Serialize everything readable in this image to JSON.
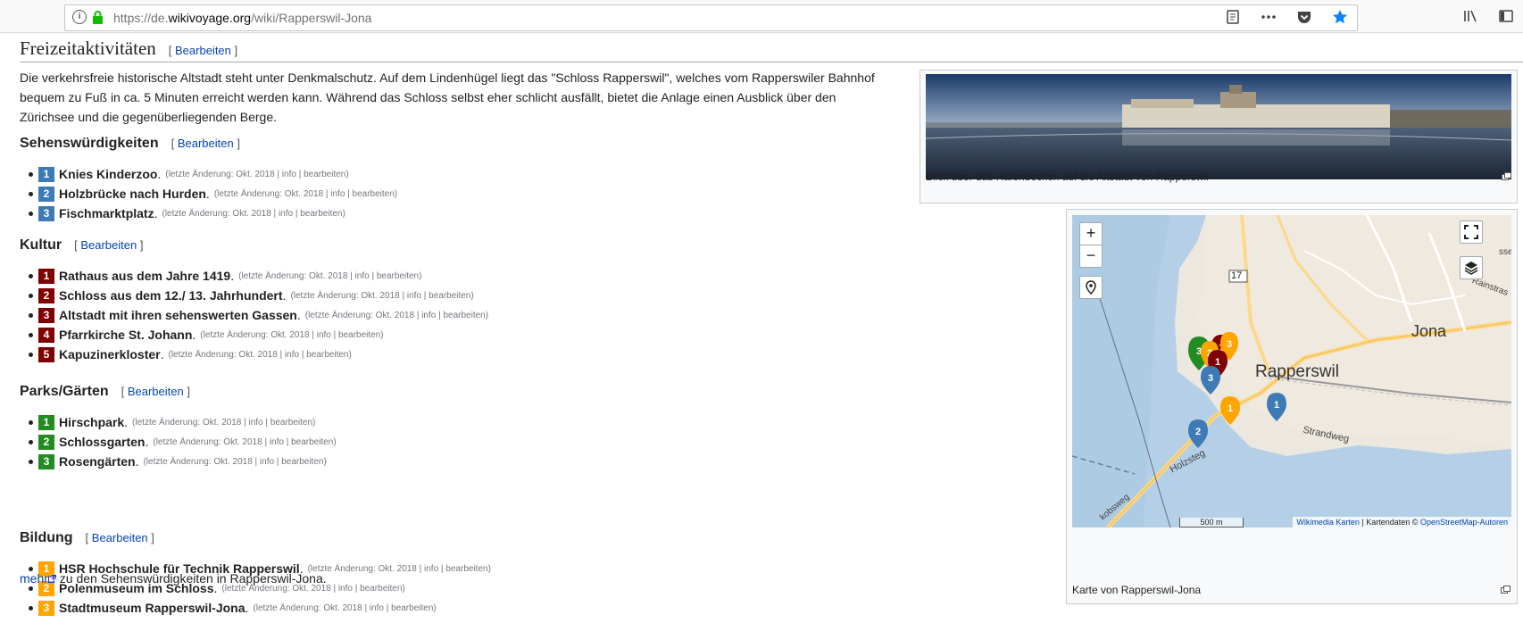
{
  "browser": {
    "url_prefix": "https://de.",
    "url_domain": "wikivoyage.org",
    "url_path": "/wiki/Rapperswil-Jona"
  },
  "section": {
    "title": "Freizeitaktivitäten",
    "edit_label": "Bearbeiten",
    "intro": "Die verkehrsfreie historische Altstadt steht unter Denkmalschutz. Auf dem Lindenhügel liegt das \"Schloss Rapperswil\", welches vom Rapperswiler Bahnhof bequem zu Fuß in ca. 5 Minuten erreicht werden kann. Während das Schloss selbst eher schlicht ausfällt, bietet die Anlage einen Ausblick über den Zürichsee und die gegenüberliegenden Berge."
  },
  "meta_text": "(letzte Änderung: Okt. 2018 | info | bearbeiten)",
  "colors": {
    "blue": "#3e7ab5",
    "red": "#7f0000",
    "green": "#228b22",
    "orange": "#ffa500",
    "link": "#0645ad"
  },
  "groups": [
    {
      "title": "Sehenswürdigkeiten",
      "edit_label": "Bearbeiten",
      "color": "#3e7ab5",
      "items": [
        "Knies Kinderzoo",
        "Holzbrücke nach Hurden",
        "Fischmarktplatz"
      ]
    },
    {
      "title": "Kultur",
      "edit_label": "Bearbeiten",
      "color": "#7f0000",
      "items": [
        "Rathaus aus dem Jahre 1419",
        "Schloss aus dem 12./ 13. Jahrhundert",
        "Altstadt mit ihren sehenswerten Gassen",
        "Pfarrkirche St. Johann",
        "Kapuzinerkloster"
      ]
    },
    {
      "title": "Parks/Gärten",
      "edit_label": "Bearbeiten",
      "color": "#228b22",
      "items": [
        "Hirschpark",
        "Schlossgarten",
        "Rosengärten"
      ]
    },
    {
      "title": "Bildung",
      "edit_label": "Bearbeiten",
      "color": "#ffa500",
      "items": [
        "HSR Hochschule für Technik Rapperswil",
        "Polenmuseum im Schloss",
        "Stadtmuseum Rapperswil-Jona"
      ]
    }
  ],
  "more": {
    "link": "mehr",
    "text": " zu den Sehenswürdigkeiten in Rapperswil-Jona."
  },
  "photo": {
    "caption": "Blick über das Hafenbecken auf die Altstadt von Rapperswil"
  },
  "map": {
    "caption": "Karte von Rapperswil-Jona",
    "zoom_in": "+",
    "zoom_out": "−",
    "label_rapperswil": "Rapperswil",
    "label_jona": "Jona",
    "label_strandweg": "Strandweg",
    "label_holzsteg": "Holzsteg",
    "label_road": "17",
    "label_rainstrasse": "Rainstras",
    "label_sse": "sse",
    "label_kobsweg": "kobsweg",
    "scale": "500 m",
    "attr_link1": "Wikimedia Karten",
    "attr_text": " | Kartendaten © ",
    "attr_link2": "OpenStreetMap-Autoren"
  }
}
